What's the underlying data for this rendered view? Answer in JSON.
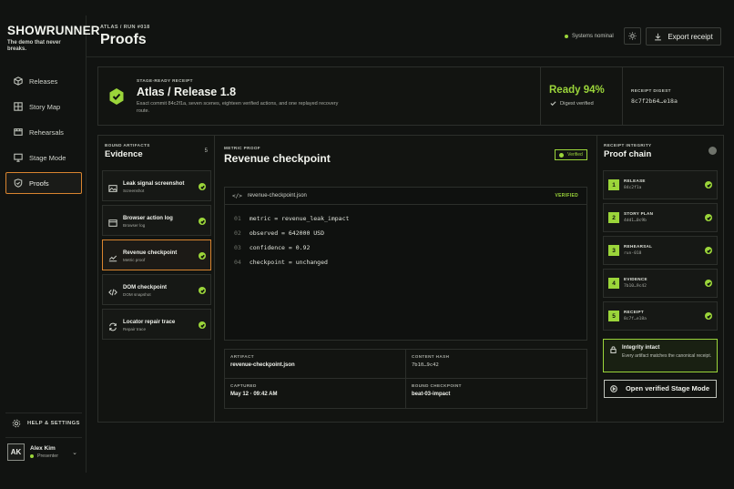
{
  "brand": {
    "name": "SHOWRUNNER",
    "tagline": "The demo that never breaks."
  },
  "nav": [
    {
      "label": "Releases",
      "icon": "cube-icon"
    },
    {
      "label": "Story Map",
      "icon": "grid-icon"
    },
    {
      "label": "Rehearsals",
      "icon": "film-icon"
    },
    {
      "label": "Stage Mode",
      "icon": "monitor-icon"
    },
    {
      "label": "Proofs",
      "icon": "shield-icon",
      "active": true
    }
  ],
  "help": {
    "label": "HELP & SETTINGS"
  },
  "user": {
    "initials": "AK",
    "name": "Alex Kim",
    "role": "Presenter"
  },
  "header": {
    "breadcrumb": "ATLAS / RUN #018",
    "title": "Proofs",
    "status": "Systems nominal",
    "export_label": "Export receipt"
  },
  "receipt": {
    "label": "STAGE-READY RECEIPT",
    "title": "Atlas / Release 1.8",
    "description": "Exact commit 84c2f1a, seven scenes, eighteen verified actions, and one replayed recovery route.",
    "ready": "Ready 94%",
    "ready_value": 94,
    "digest_verified": "Digest verified",
    "digest_label": "RECEIPT DIGEST",
    "digest": "8c7f2b64…e18a"
  },
  "evidence": {
    "label": "BOUND ARTIFACTS",
    "title": "Evidence",
    "count": "5",
    "items": [
      {
        "title": "Leak signal screenshot",
        "sub": "Screenshot",
        "icon": "image-icon"
      },
      {
        "title": "Browser action log",
        "sub": "Browser log",
        "icon": "browser-icon"
      },
      {
        "title": "Revenue checkpoint",
        "sub": "Metric proof",
        "icon": "trend-icon",
        "active": true
      },
      {
        "title": "DOM checkpoint",
        "sub": "DOM snapshot",
        "icon": "code-icon"
      },
      {
        "title": "Locator repair trace",
        "sub": "Repair trace",
        "icon": "refresh-icon"
      }
    ]
  },
  "metric": {
    "label": "METRIC PROOF",
    "title": "Revenue checkpoint",
    "badge": "Verified",
    "file": "revenue-checkpoint.json",
    "file_status": "VERIFIED",
    "lines": [
      {
        "n": "01",
        "text": "metric = revenue_leak_impact"
      },
      {
        "n": "02",
        "text": "observed = 642000 USD"
      },
      {
        "n": "03",
        "text": "confidence = 0.92"
      },
      {
        "n": "04",
        "text": "checkpoint = unchanged"
      }
    ],
    "meta": {
      "artifact_k": "ARTIFACT",
      "artifact_v": "revenue-checkpoint.json",
      "hash_k": "CONTENT HASH",
      "hash_v": "7b10…9c42",
      "captured_k": "CAPTURED",
      "captured_v": "May 12 · 09:42 AM",
      "bound_k": "BOUND CHECKPOINT",
      "bound_v": "beat-03-impact"
    }
  },
  "chain": {
    "label": "RECEIPT INTEGRITY",
    "title": "Proof chain",
    "links": [
      {
        "n": "1",
        "k": "RELEASE",
        "h": "84c2f1a"
      },
      {
        "n": "2",
        "k": "STORY PLAN",
        "h": "4dd1…0c9b"
      },
      {
        "n": "3",
        "k": "REHEARSAL",
        "h": "run-018"
      },
      {
        "n": "4",
        "k": "EVIDENCE",
        "h": "7b10…9c42"
      },
      {
        "n": "5",
        "k": "RECEIPT",
        "h": "8c7f…e18a"
      }
    ],
    "integrity_title": "Integrity intact",
    "integrity_desc": "Every artifact matches the canonical receipt.",
    "open_label": "Open verified Stage Mode"
  },
  "colors": {
    "accent": "#9bd53a",
    "active_border": "#d9842f",
    "background": "#111311"
  }
}
